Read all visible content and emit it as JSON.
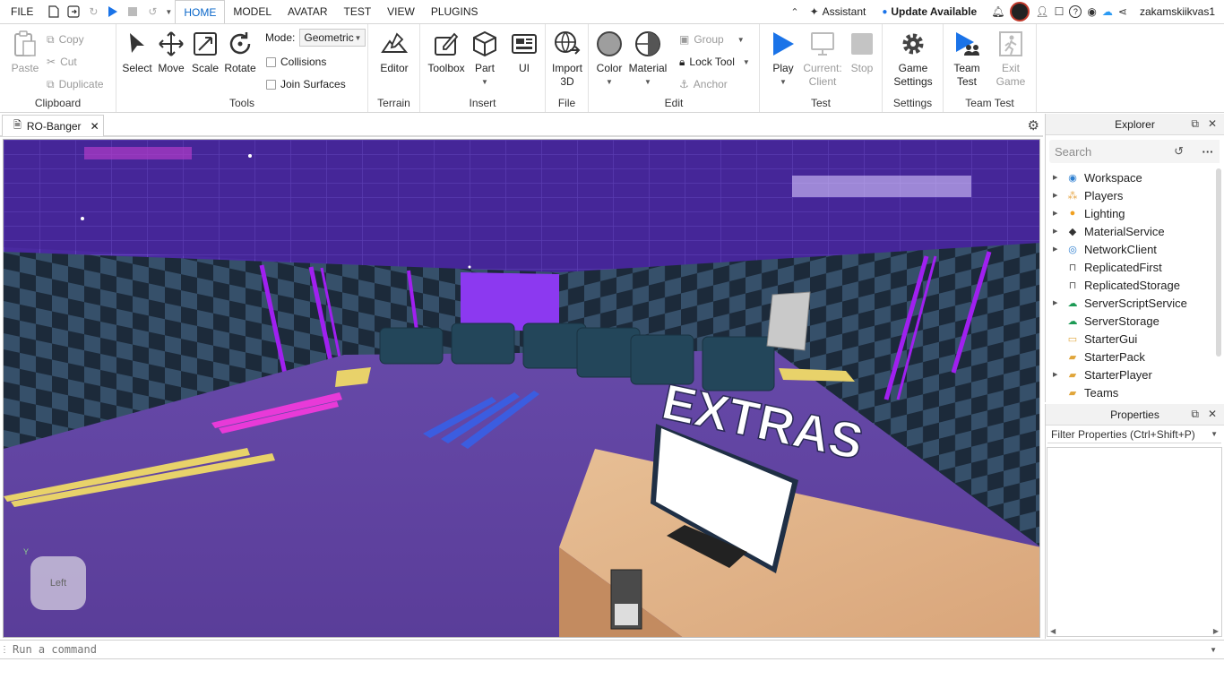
{
  "menubar": {
    "file": "FILE",
    "tabs": [
      "HOME",
      "MODEL",
      "AVATAR",
      "TEST",
      "VIEW",
      "PLUGINS"
    ],
    "active_tab": "HOME",
    "assistant": "Assistant",
    "update": "Update Available",
    "username": "zakamskiikvas1"
  },
  "ribbon": {
    "clipboard": {
      "label": "Clipboard",
      "paste": "Paste",
      "copy": "Copy",
      "cut": "Cut",
      "duplicate": "Duplicate"
    },
    "tools": {
      "label": "Tools",
      "select": "Select",
      "move": "Move",
      "scale": "Scale",
      "rotate": "Rotate",
      "mode_label": "Mode:",
      "mode_value": "Geometric",
      "collisions": "Collisions",
      "join_surfaces": "Join Surfaces"
    },
    "terrain": {
      "label": "Terrain",
      "editor": "Editor"
    },
    "insert": {
      "label": "Insert",
      "toolbox": "Toolbox",
      "part": "Part",
      "ui": "UI"
    },
    "file": {
      "label": "File",
      "import_3d_line1": "Import",
      "import_3d_line2": "3D"
    },
    "edit": {
      "label": "Edit",
      "color": "Color",
      "material": "Material",
      "group": "Group",
      "lock_tool": "Lock Tool",
      "anchor": "Anchor"
    },
    "test": {
      "label": "Test",
      "play": "Play",
      "current_client_line1": "Current:",
      "current_client_line2": "Client",
      "stop": "Stop"
    },
    "settings": {
      "label": "Settings",
      "game_settings_line1": "Game",
      "game_settings_line2": "Settings"
    },
    "team_test": {
      "label": "Team Test",
      "team_test_line1": "Team",
      "team_test_line2": "Test",
      "exit_game_line1": "Exit",
      "exit_game_line2": "Game"
    }
  },
  "document": {
    "tab_title": "RO-Banger"
  },
  "viewport": {
    "sign_text": "EXTRAS",
    "view_cube_face": "Left",
    "axis_y": "Y"
  },
  "explorer": {
    "title": "Explorer",
    "search_placeholder": "Search",
    "items": [
      {
        "label": "Workspace",
        "expandable": true,
        "icon": "globe-icon"
      },
      {
        "label": "Players",
        "expandable": true,
        "icon": "players-icon"
      },
      {
        "label": "Lighting",
        "expandable": true,
        "icon": "lightbulb-icon"
      },
      {
        "label": "MaterialService",
        "expandable": true,
        "icon": "material-service-icon"
      },
      {
        "label": "NetworkClient",
        "expandable": true,
        "icon": "network-icon"
      },
      {
        "label": "ReplicatedFirst",
        "expandable": false,
        "icon": "replicated-first-icon"
      },
      {
        "label": "ReplicatedStorage",
        "expandable": false,
        "icon": "replicated-storage-icon"
      },
      {
        "label": "ServerScriptService",
        "expandable": true,
        "icon": "server-script-icon"
      },
      {
        "label": "ServerStorage",
        "expandable": false,
        "icon": "server-storage-icon"
      },
      {
        "label": "StarterGui",
        "expandable": false,
        "icon": "starter-gui-icon"
      },
      {
        "label": "StarterPack",
        "expandable": false,
        "icon": "starter-pack-icon"
      },
      {
        "label": "StarterPlayer",
        "expandable": true,
        "icon": "starter-player-icon"
      },
      {
        "label": "Teams",
        "expandable": false,
        "icon": "teams-icon"
      }
    ]
  },
  "properties": {
    "title": "Properties",
    "filter_placeholder": "Filter Properties (Ctrl+Shift+P)"
  },
  "command_bar": {
    "placeholder": "Run a command"
  },
  "colors": {
    "accent_blue": "#0a67c9",
    "play_blue": "#1a73e8",
    "floor_purple": "#5c3fa3",
    "neon_purple": "#a020f0"
  }
}
